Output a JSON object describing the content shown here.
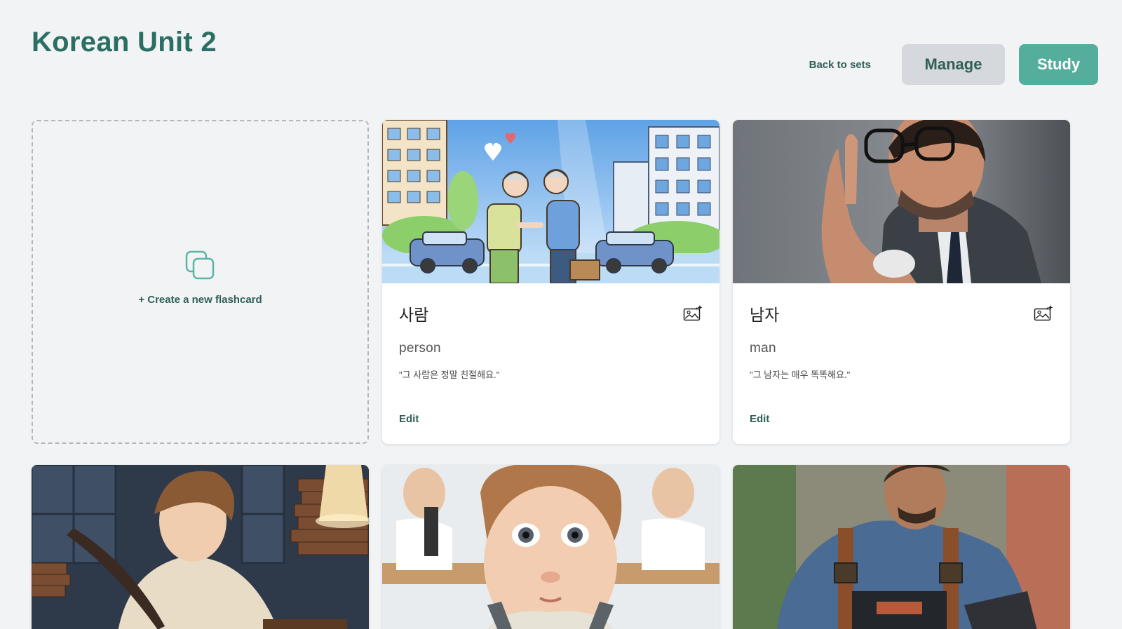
{
  "header": {
    "title": "Korean Unit 2",
    "back_label": "Back to sets",
    "manage_label": "Manage",
    "study_label": "Study"
  },
  "new_card": {
    "label": "+ Create a new flashcard",
    "icon": "copy-cards-icon"
  },
  "cards": [
    {
      "term": "사람",
      "definition": "person",
      "example": "\"그 사람은 정말 친절해요.\"",
      "edit_label": "Edit",
      "image": "illustration of elderly couple shaking hands on city street"
    },
    {
      "term": "남자",
      "definition": "man",
      "example": "\"그 남자는 매우 똑똑해요.\"",
      "edit_label": "Edit",
      "image": "photo of man in glasses and suit thinking"
    }
  ],
  "partial_cards": [
    {
      "image": "woman writing with quill among books"
    },
    {
      "image": "curious toddler in a classroom lab"
    },
    {
      "image": "worker in denim overalls"
    }
  ],
  "colors": {
    "accent": "#55ad9b",
    "title": "#2a6e64",
    "background": "#f2f3f5"
  }
}
